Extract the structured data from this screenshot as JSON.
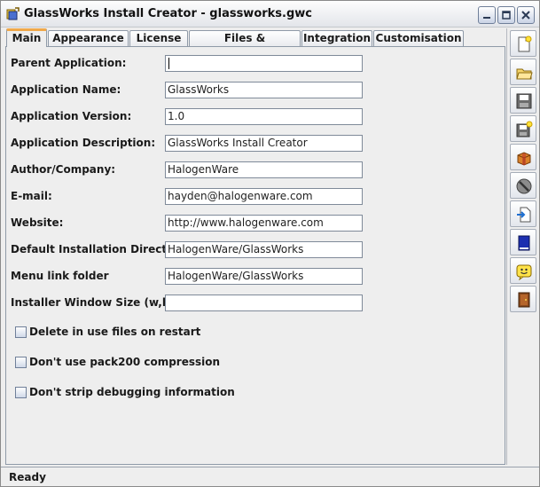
{
  "window": {
    "title": "GlassWorks Install Creator - glassworks.gwc",
    "controls": [
      "minimize-icon",
      "maximize-icon",
      "close-icon"
    ]
  },
  "tabs": [
    {
      "label": "Main",
      "active": true
    },
    {
      "label": "Appearance",
      "active": false
    },
    {
      "label": "License",
      "active": false
    },
    {
      "label": "Files & Directories",
      "active": false
    },
    {
      "label": "Integration",
      "active": false
    },
    {
      "label": "Customisation",
      "active": false
    }
  ],
  "form": {
    "fields": [
      {
        "label": "Parent Application:",
        "value": ""
      },
      {
        "label": "Application Name:",
        "value": "GlassWorks"
      },
      {
        "label": "Application Version:",
        "value": "1.0"
      },
      {
        "label": "Application Description:",
        "value": "GlassWorks Install Creator"
      },
      {
        "label": "Author/Company:",
        "value": "HalogenWare"
      },
      {
        "label": "E-mail:",
        "value": "hayden@halogenware.com"
      },
      {
        "label": "Website:",
        "value": "http://www.halogenware.com"
      },
      {
        "label": "Default Installation Directory:",
        "value": "HalogenWare/GlassWorks"
      },
      {
        "label": "Menu link folder",
        "value": "HalogenWare/GlassWorks"
      },
      {
        "label": "Installer Window Size (w,h):",
        "value": ""
      }
    ],
    "checkboxes": [
      {
        "label": "Delete in use files on restart",
        "checked": false
      },
      {
        "label": "Don't use pack200 compression",
        "checked": false
      },
      {
        "label": "Don't strip debugging information",
        "checked": false
      }
    ]
  },
  "toolbar": {
    "buttons": [
      {
        "icon": "new-file-icon"
      },
      {
        "icon": "open-folder-icon"
      },
      {
        "icon": "save-disk-icon"
      },
      {
        "icon": "save-as-icon"
      },
      {
        "icon": "build-package-icon"
      },
      {
        "icon": "stop-icon"
      },
      {
        "icon": "import-icon"
      },
      {
        "icon": "book-icon"
      },
      {
        "icon": "smiley-icon"
      },
      {
        "icon": "exit-door-icon"
      }
    ]
  },
  "status": {
    "text": "Ready"
  },
  "colors": {
    "active_tab_accent": "#f0a84a",
    "window_bg": "#eeeeee",
    "border": "#8f9aa8"
  }
}
